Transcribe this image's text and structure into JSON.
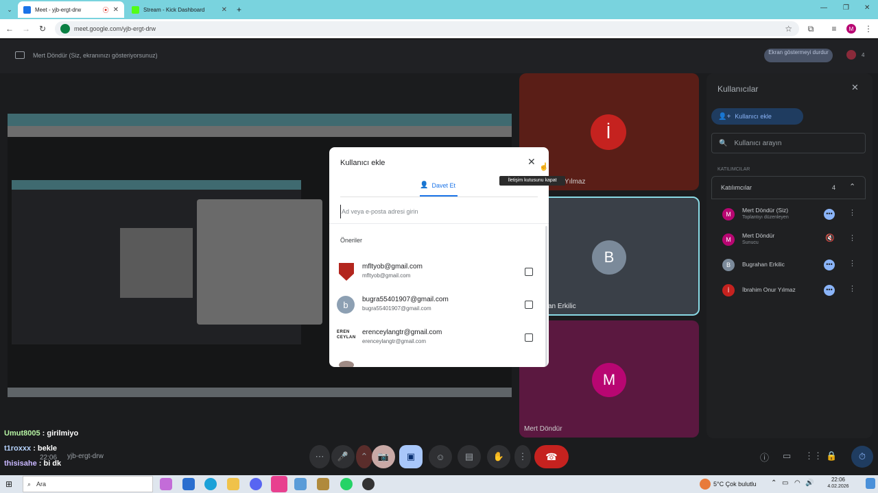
{
  "browser": {
    "tabs": [
      {
        "title": "Meet - yjb-ergt-drw",
        "active": true,
        "favicon_color": "#1a73e8"
      },
      {
        "title": "Stream - Kick Dashboard",
        "active": false,
        "favicon_color": "#53fc18"
      }
    ],
    "url": "meet.google.com/yjb-ergt-drw",
    "profile_initial": "M"
  },
  "meet": {
    "presenting_text": "Mert Döndür (Siz, ekranınızı gösteriyorsunuz)",
    "stop_presenting_label": "Ekran göstermeyi durdur",
    "people_count": "4",
    "tiles": [
      {
        "initial": "İ",
        "name": "İbrahim Onur Yılmaz",
        "visible_name": "r Yılmaz",
        "color": "#c5221f",
        "bg": "#5a1e17"
      },
      {
        "initial": "B",
        "name": "Bugrahan Erkilic",
        "visible_name": "an Erkilic",
        "color": "#7b8a9a",
        "bg": "#3a4048"
      },
      {
        "initial": "M",
        "name": "Mert Döndür",
        "visible_name": "Mert Döndür",
        "color": "#b80672",
        "bg": "#5b1840"
      }
    ],
    "panel": {
      "title": "Kullanıcılar",
      "add_user_label": "Kullanıcı ekle",
      "search_placeholder": "Kullanıcı arayın",
      "section_label": "KATILIMCILAR",
      "participants_header": "Katılımcılar",
      "participants_count": "4",
      "participants": [
        {
          "name": "Mert Döndür (Siz)",
          "sub": "Toplantıyı düzenleyen",
          "initial": "M",
          "color": "#b80672"
        },
        {
          "name": "Mert Döndür",
          "sub": "Sunucu",
          "initial": "M",
          "color": "#b80672"
        },
        {
          "name": "Bugrahan Erkilic",
          "sub": "",
          "initial": "B",
          "color": "#7b8a9a"
        },
        {
          "name": "İbrahim Onur Yılmaz",
          "sub": "",
          "initial": "İ",
          "color": "#c5221f"
        }
      ]
    },
    "meeting_time": "22:06",
    "meeting_code": "yjb-ergt-drw"
  },
  "dialog": {
    "title": "Kullanıcı ekle",
    "tab_label": "Davet Et",
    "input_placeholder": "Ad veya e-posta adresi girin",
    "suggestions_label": "Öneriler",
    "close_tooltip": "İletişim kutusunu kapat",
    "suggestions": [
      {
        "title": "mfltyob@gmail.com",
        "email": "mfltyob@gmail.com",
        "avatar_text": "",
        "avatar_color": "#b3261e"
      },
      {
        "title": "bugra55401907@gmail.com",
        "email": "bugra55401907@gmail.com",
        "avatar_text": "b",
        "avatar_color": "#8da0b3"
      },
      {
        "title": "erenceylangtr@gmail.com",
        "email": "erenceylangtr@gmail.com",
        "avatar_text": "EREN CEYLAN",
        "avatar_color": "#ffffff"
      }
    ]
  },
  "chat": [
    {
      "user": "Umut8005",
      "message": "girilmiyo"
    },
    {
      "user": "t1roxxx",
      "message": "bekle"
    },
    {
      "user": "thisisahe",
      "message": "bi dk"
    }
  ],
  "taskbar": {
    "search_placeholder": "Ara",
    "weather": "5°C Çok bulutlu",
    "time": "22:06",
    "date": "4.02.2026"
  }
}
